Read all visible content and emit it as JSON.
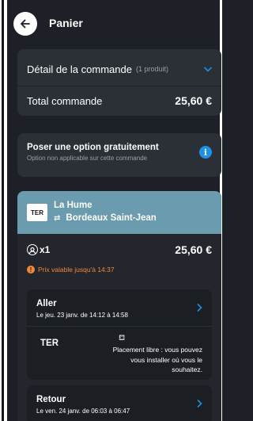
{
  "header": {
    "title": "Panier"
  },
  "summary": {
    "detail_label": "Détail de la commande",
    "detail_count": "(1 produit)",
    "total_label": "Total commande",
    "total_value": "25,60 €"
  },
  "option": {
    "title": "Poser une option gratuitement",
    "subtitle": "Option non applicable sur cette commande"
  },
  "trip": {
    "logo": "TER",
    "from": "La Hume",
    "to": "Bordeaux Saint-Jean",
    "passengers": "x1",
    "price": "25,60 €",
    "validity": "Prix valable jusqu'à 14:37",
    "outbound": {
      "title": "Aller",
      "date": "Le jeu. 23 janv. de 14:12 à 14:58",
      "train_type": "TER",
      "placement": "Placement libre : vous pouvez vous installer où vous le souhaitez."
    },
    "return": {
      "title": "Retour",
      "date": "Le ven. 24 janv. de 06:03 à 06:47"
    }
  },
  "colors": {
    "background": "#1d2026",
    "card": "#2b2f36",
    "accent_blue": "#1e90e6",
    "trip_header": "#6b9bae",
    "warning": "#f0873a"
  },
  "icons": [
    "back-arrow-icon",
    "chevron-down-icon",
    "info-icon",
    "swap-icon",
    "passenger-icon",
    "warning-icon",
    "chevron-right-icon",
    "seat-icon"
  ]
}
